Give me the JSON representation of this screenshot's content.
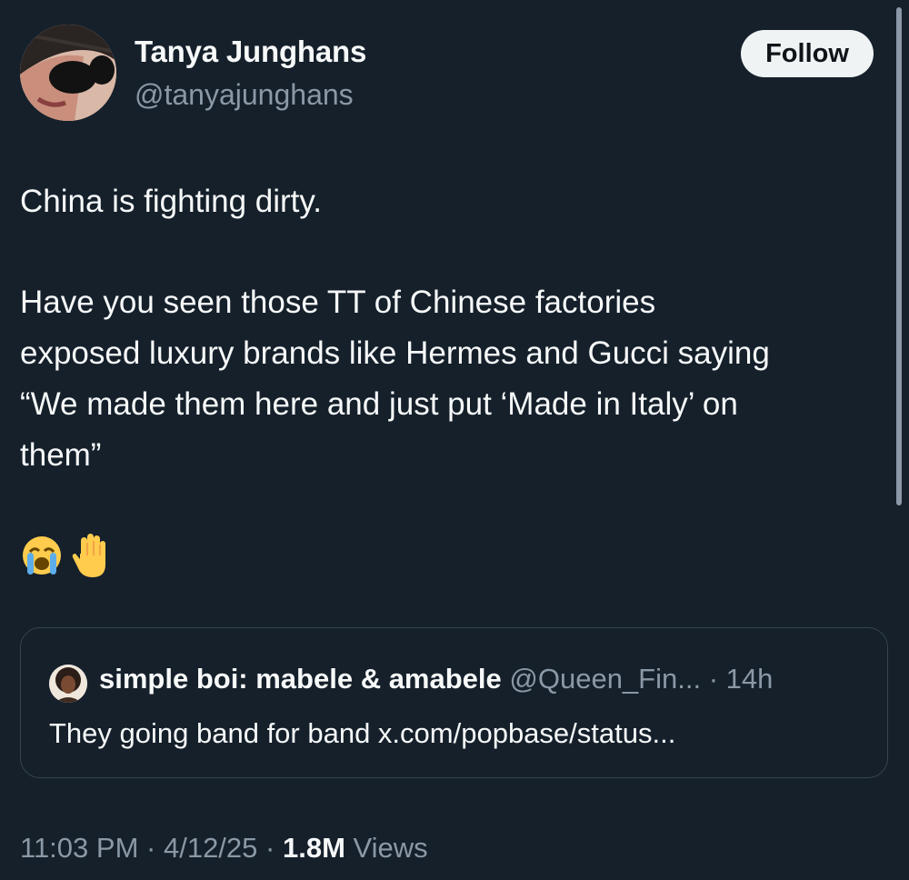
{
  "author": {
    "name": "Tanya Junghans",
    "handle": "@tanyajunghans",
    "follow_label": "Follow"
  },
  "tweet": {
    "lines": [
      "China is fighting dirty.",
      "Have you seen those TT of Chinese factories",
      "exposed luxury brands like Hermes and Gucci saying",
      "“We made them here and just put ‘Made in Italy’ on",
      "them”"
    ],
    "emojis": [
      "crying-face",
      "raised-hand"
    ]
  },
  "quote": {
    "name": "simple boi: mabele & amabele",
    "handle": "@Queen_Fin...",
    "separator": "·",
    "age": "14h",
    "text": "They going band for band x.com/popbase/status..."
  },
  "meta": {
    "time": "11:03 PM",
    "date": "4/12/25",
    "separator": "·",
    "views_count": "1.8M",
    "views_label": "Views"
  },
  "colors": {
    "background": "#15202b",
    "text": "#f7f9f9",
    "secondary": "#8b98a5",
    "border": "#38444d",
    "follow_bg": "#eff3f4"
  }
}
